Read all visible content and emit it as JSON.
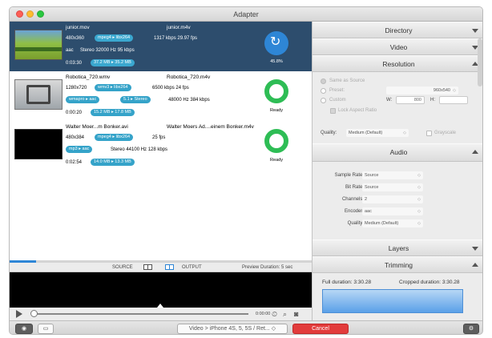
{
  "window": {
    "title": "Adapter"
  },
  "files": [
    {
      "name": "junior.mov",
      "output_name": "junior.m4v",
      "dims": "480x360",
      "codec_pill": "mpeg4 ▸ libx264",
      "bitrate": "1317 kbps  29.97 fps",
      "audio_codec": "aac",
      "audio_info": "Stereo  32000 Hz  95 kbps",
      "duration": "0:03:30",
      "size_pill": "37.2 MB ▸ 35.2 MB",
      "status": "45.8%",
      "progress": 0.458,
      "selected": true
    },
    {
      "name": "Robotica_720.wmv",
      "output_name": "Robotica_720.m4v",
      "dims": "1280x720",
      "codec_pill": "wmv3 ▸ libx264",
      "bitrate": "6500 kbps  24 fps",
      "audio_codec": "wmapro ▸ aac",
      "audio_channels": "5.1 ▸ Stereo",
      "audio_info": "48000 Hz  384 kbps",
      "duration": "0:00:20",
      "size_pill": "15.2 MB ▸ 17.8 MB",
      "status": "Ready",
      "selected": false
    },
    {
      "name": "Walter Moer...m Bonker.avi",
      "output_name": "Walter Moers Ad....einem Bonker.m4v",
      "dims": "480x384",
      "codec_pill": "mpeg4 ▸ libx264",
      "bitrate": "25 fps",
      "audio_codec": "mp3 ▸ aac",
      "audio_info": "Stereo  44100 Hz  128 kbps",
      "duration": "0:02:54",
      "size_pill": "14.0 MB ▸ 13.3 MB",
      "status": "Ready",
      "selected": false
    }
  ],
  "viewbar": {
    "source_label": "SOURCE",
    "output_label": "OUTPUT",
    "preview_duration": "Preview Duration:  5 sec"
  },
  "player": {
    "timecode": "0:00:00"
  },
  "bottom": {
    "preset": "Video > iPhone 4S, 5, 5S / Ret...",
    "cancel": "Cancel",
    "eye_icon": "eye-icon",
    "terminal_icon": "terminal-icon",
    "gear_icon": "gear-icon"
  },
  "panel": {
    "sections": {
      "directory": "Directory",
      "video": "Video",
      "resolution": "Resolution",
      "audio": "Audio",
      "layers": "Layers",
      "trimming": "Trimming"
    },
    "resolution": {
      "same_as_source": "Same as Source",
      "preset": "Preset:",
      "preset_value": "960x540",
      "custom": "Custom",
      "w_label": "W:",
      "w_value": "800",
      "h_label": "H:",
      "lock_aspect": "Lock Aspect Ratio",
      "quality_label": "Quality:",
      "quality_value": "Medium (Default)",
      "grayscale": "Grayscale"
    },
    "audio": {
      "sample_rate_label": "Sample Rate:",
      "sample_rate_value": "Source",
      "bit_rate_label": "Bit Rate:",
      "bit_rate_value": "Source",
      "channels_label": "Channels:",
      "channels_value": "2",
      "encoder_label": "Encoder:",
      "encoder_value": "aac",
      "quality_label": "Quality:",
      "quality_value": "Medium (Default)"
    },
    "trimming": {
      "full_duration": "Full duration: 3:30.28",
      "cropped_duration": "Cropped duration: 3:30.28"
    }
  }
}
